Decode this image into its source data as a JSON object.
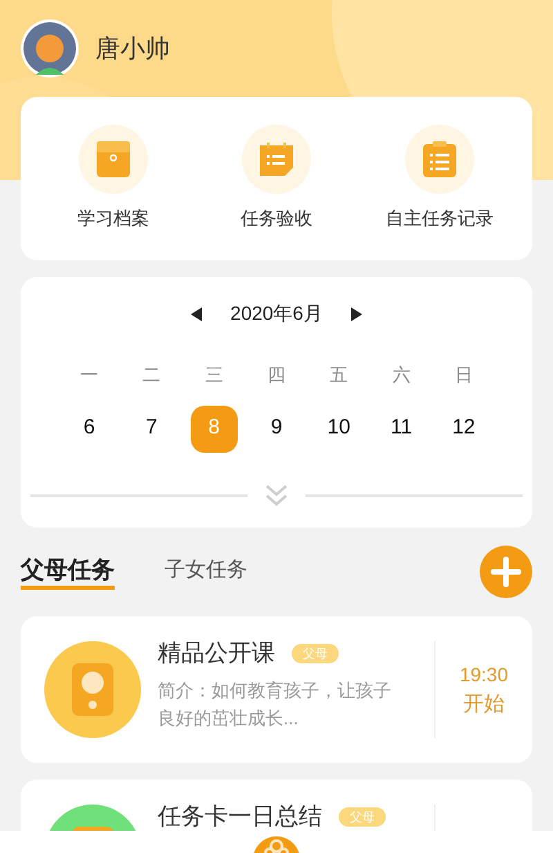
{
  "user": {
    "name": "唐小帅"
  },
  "shortcuts": [
    {
      "label": "学习档案",
      "kind": "folder"
    },
    {
      "label": "任务验收",
      "kind": "note"
    },
    {
      "label": "自主任务记录",
      "kind": "clipboard"
    }
  ],
  "calendar": {
    "month": "2020年6月",
    "weekdays": [
      "一",
      "二",
      "三",
      "四",
      "五",
      "六",
      "日"
    ],
    "dates": [
      {
        "label": "6",
        "selected": false
      },
      {
        "label": "7",
        "selected": false
      },
      {
        "label": "8",
        "selected": true
      },
      {
        "label": "9",
        "selected": false
      },
      {
        "label": "10",
        "selected": false
      },
      {
        "label": "11",
        "selected": false
      },
      {
        "label": "12",
        "selected": false
      }
    ]
  },
  "tabs": [
    {
      "label": "父母任务",
      "selected": true
    },
    {
      "label": "子女任务",
      "selected": false
    }
  ],
  "tasks": [
    {
      "title": "精品公开课",
      "tag": "父母",
      "color": "#fbc94e",
      "description": "简介：如何教育孩子，让孩子良好的茁壮成长...",
      "time": "19:30",
      "action": "开始"
    },
    {
      "title": "任务卡一日总结",
      "tag": "父母",
      "color": "#6fe07a"
    }
  ]
}
